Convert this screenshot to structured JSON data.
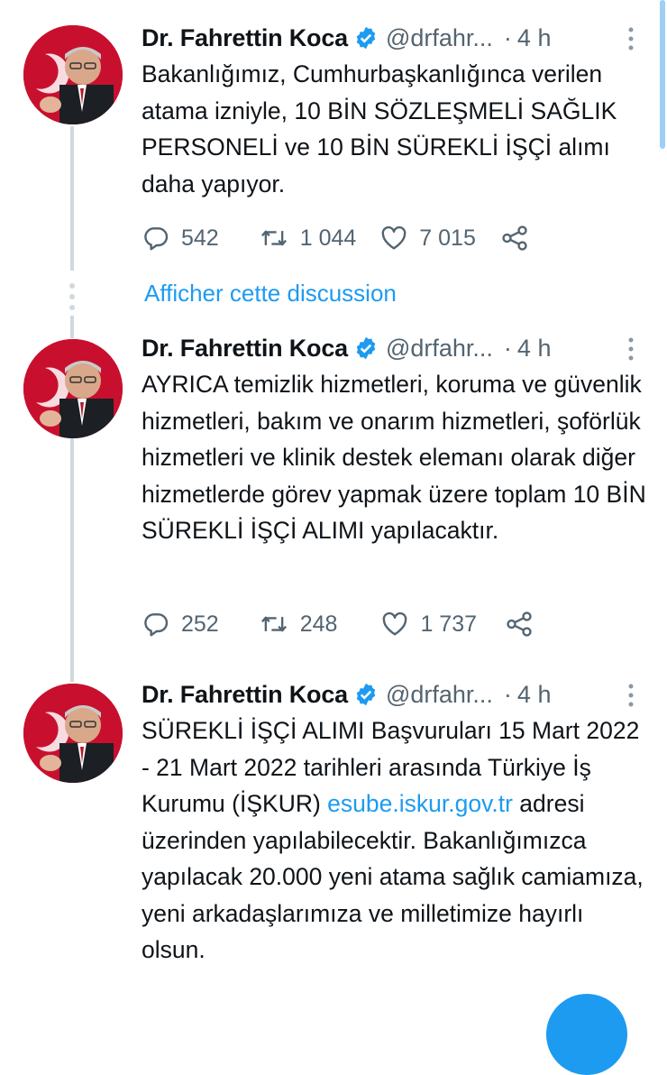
{
  "tweets": [
    {
      "author": "Dr. Fahrettin Koca",
      "handle": "@drfahr...",
      "dot": "·",
      "time": "4 h",
      "text": "Bakanlığımız, Cumhurbaşkanlığınca verilen atama izniyle, 10 BİN SÖZLEŞMELİ SAĞLIK PERSONELİ ve 10 BİN SÜREKLİ İŞÇİ alımı daha yapıyor.",
      "replies": "542",
      "retweets": "1 044",
      "likes": "7 015"
    },
    {
      "author": "Dr. Fahrettin Koca",
      "handle": "@drfahr...",
      "dot": "·",
      "time": "4 h",
      "text": "AYRICA temizlik hizmetleri, koruma ve güvenlik hizmetleri, bakım ve onarım hizmetleri, şoförlük hizmetleri ve klinik destek elemanı olarak diğer hizmetlerde görev yapmak üzere toplam 10 BİN SÜREKLİ İŞÇİ ALIMI yapılacaktır.",
      "replies": "252",
      "retweets": "248",
      "likes": "1 737"
    },
    {
      "author": "Dr. Fahrettin Koca",
      "handle": "@drfahr...",
      "dot": "·",
      "time": "4 h",
      "text_before": "SÜREKLİ İŞÇİ ALIMI Başvuruları 15 Mart 2022 - 21 Mart 2022 tarihleri arasında Türkiye İş Kurumu (İŞKUR)",
      "link": "esube.iskur.gov.tr",
      "text_after": "adresi üzerinden yapılabilecektir. Bakanlığımızca yapılacak 20.000 yeni atama sağlık camiamıza, yeni arkadaşlarımıza ve milletimize hayırlı olsun."
    }
  ],
  "show_thread": "Afficher cette discussion",
  "colors": {
    "accent": "#1d9bf0",
    "text": "#0f1419",
    "secondary": "#536471",
    "thread_line": "#cfd9de"
  },
  "icons": [
    "verified-badge-icon",
    "more-options-icon",
    "reply-icon",
    "retweet-icon",
    "like-icon",
    "share-icon"
  ]
}
